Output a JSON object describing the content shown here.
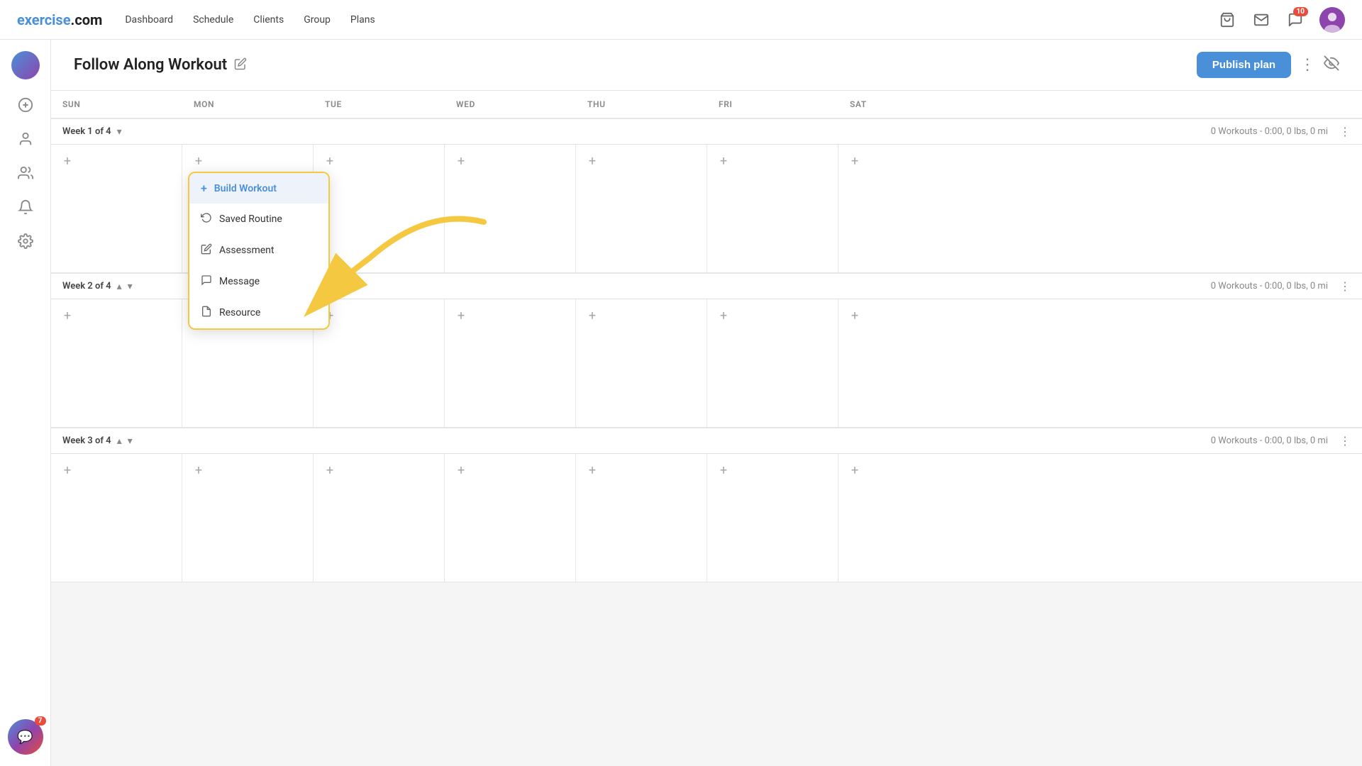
{
  "app": {
    "logo_text": "exercise",
    "logo_suffix": ".com"
  },
  "nav": {
    "links": [
      "Dashboard",
      "Schedule",
      "Clients",
      "Group",
      "Plans"
    ]
  },
  "header": {
    "title": "Follow Along Workout",
    "publish_label": "Publish plan",
    "notification_count": "10",
    "chat_count": "7"
  },
  "calendar": {
    "days": [
      "SUN",
      "MON",
      "TUE",
      "WED",
      "THU",
      "FRI",
      "SAT"
    ]
  },
  "weeks": [
    {
      "label": "Week 1 of 4",
      "stats": "0 Workouts - 0:00, 0 lbs, 0 mi",
      "show_up": false,
      "show_down": true
    },
    {
      "label": "Week 2 of 4",
      "stats": "0 Workouts - 0:00, 0 lbs, 0 mi",
      "show_up": true,
      "show_down": true
    },
    {
      "label": "Week 3 of 4",
      "stats": "0 Workouts - 0:00, 0 lbs, 0 mi",
      "show_up": true,
      "show_down": true
    }
  ],
  "dropdown": {
    "items": [
      {
        "icon": "+",
        "label": "Build Workout",
        "highlighted": true
      },
      {
        "icon": "↺",
        "label": "Saved Routine",
        "highlighted": false
      },
      {
        "icon": "✎",
        "label": "Assessment",
        "highlighted": false
      },
      {
        "icon": "💬",
        "label": "Message",
        "highlighted": false
      },
      {
        "icon": "📄",
        "label": "Resource",
        "highlighted": false
      }
    ]
  }
}
